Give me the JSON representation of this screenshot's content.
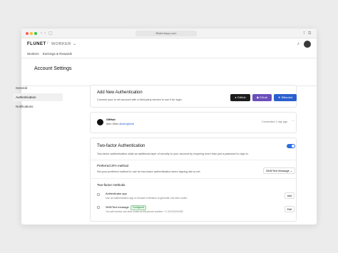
{
  "browser": {
    "url": "Bilaterdapp.com"
  },
  "header": {
    "logo": "FLUNET",
    "separator": "/",
    "product": "WORKER",
    "product_chevron": "⌄",
    "bell_icon": "bell-icon",
    "nav": [
      "Workers",
      "Earnings & Rewards"
    ]
  },
  "page": {
    "title": "Account Settings"
  },
  "sidebar": {
    "items": [
      {
        "label": "General"
      },
      {
        "label": "Authentication"
      },
      {
        "label": "Notifications"
      }
    ]
  },
  "add_auth": {
    "title": "Add New Authentication",
    "subtitle": "Connect your to net account with a third-party service to use it for login.",
    "buttons": [
      {
        "label": "GitHub",
        "color": "#1d1d1d"
      },
      {
        "label": "GitLab",
        "color": "#6b4fbb"
      },
      {
        "label": "Bitbucket",
        "color": "#2b5fce"
      }
    ]
  },
  "connected": {
    "provider": "GitHub",
    "user": "Alex Giles",
    "handle": "@alexgiles6",
    "status": "Connected 1 day ago",
    "more": "···"
  },
  "twofa": {
    "title": "Two-factor Authentication",
    "subtitle": "Two-factor authentication adds an additional layer of security to your account by requiring more than just a password to sign in.",
    "enabled": true,
    "preferred_title": "Preferred 2FA method",
    "preferred_sub": "Set your preferred method to use for two-factor authentication when signing into to.net",
    "preferred_value": "SMS/Text Message ⌄",
    "methods_title": "Two-factor methods",
    "methods": [
      {
        "name": "Authenticator app",
        "desc": "Use an authentication app or browser extension to generate one-time codes.",
        "action": "Add",
        "badge": ""
      },
      {
        "name": "SMS/Text message",
        "desc": "You will receive one-time codes at this phone number: +1 XXXXXXXX52",
        "action": "Edit",
        "badge": "Configured"
      }
    ]
  }
}
